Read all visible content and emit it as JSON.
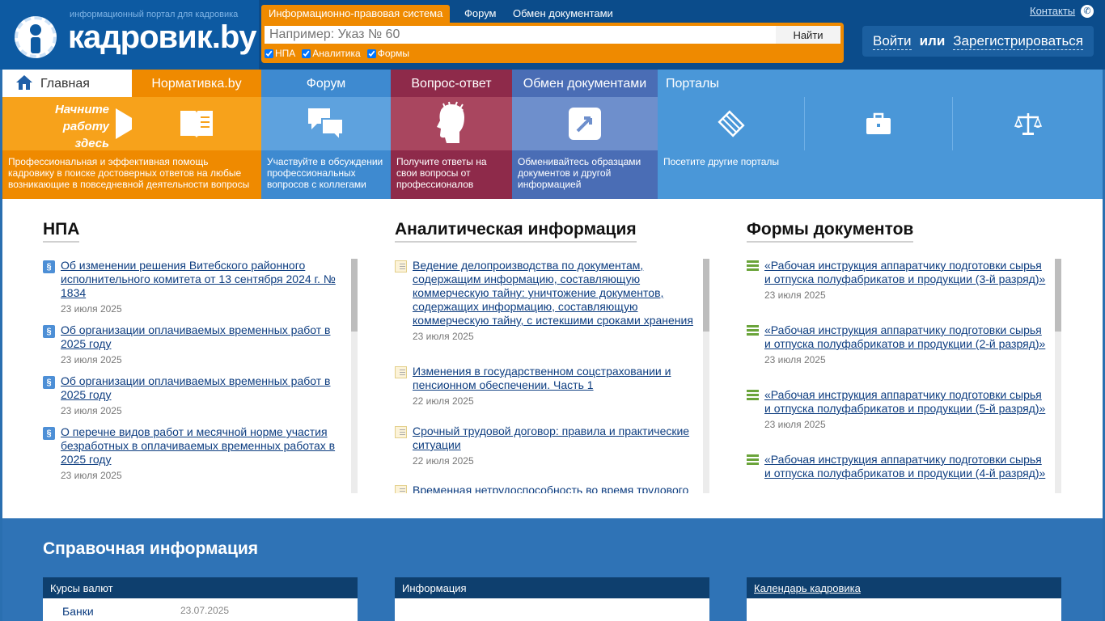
{
  "header": {
    "tagline": "информационный портал для кадровика",
    "brand": "кадровик.by",
    "search_tabs": [
      "Информационно-правовая система",
      "Форум",
      "Обмен документами"
    ],
    "search_placeholder": "Например: Указ № 60",
    "search_button": "Найти",
    "filters": [
      "НПА",
      "Аналитика",
      "Формы"
    ],
    "contacts": "Контакты",
    "login": "Войти",
    "or": "или",
    "register": "Зарегистрироваться"
  },
  "nav": {
    "home": "Главная",
    "start_here": "Начните работу здесь",
    "tabs": [
      "Нормативка.by",
      "Форум",
      "Вопрос-ответ",
      "Обмен документами",
      "Порталы"
    ],
    "descriptions": [
      "Профессиональная и эффективная помощь кадровику в поиске достоверных ответов на любые возникающие в повседневной деятельности вопросы",
      "Участвуйте в обсуждении профессиональных вопросов с коллегами",
      "Получите ответы на свои вопросы от профессионалов",
      "Обменивайтесь образцами документов и другой информацией",
      "Посетите другие порталы"
    ]
  },
  "columns": {
    "npa": {
      "title": "НПА",
      "items": [
        {
          "title": "Об изменении решения Витебского районного исполнительного комитета от 13 сентября 2024 г. № 1834",
          "date": "23 июля 2025"
        },
        {
          "title": "Об организации оплачиваемых временных работ в 2025 году",
          "date": "23 июля 2025"
        },
        {
          "title": "Об организации оплачиваемых временных работ в 2025 году",
          "date": "23 июля 2025"
        },
        {
          "title": "О перечне видов работ и месячной норме участия безработных в оплачиваемых временных работах в 2025 году",
          "date": "23 июля 2025"
        }
      ]
    },
    "analytics": {
      "title": "Аналитическая информация",
      "items": [
        {
          "title": "Ведение делопроизводства по документам, содержащим информацию, составляющую коммерческую тайну: уничтожение документов, содержащих информацию, составляющую коммерческую тайну, с истекшими сроками хранения",
          "date": "23 июля 2025"
        },
        {
          "title": "Изменения в государственном соцстраховании и пенсионном обеспечении. Часть 1",
          "date": "22 июля 2025"
        },
        {
          "title": "Срочный трудовой договор: правила и практические ситуации",
          "date": "22 июля 2025"
        },
        {
          "title": "Временная нетрудоспособность во время трудового",
          "date": ""
        }
      ]
    },
    "forms": {
      "title": "Формы документов",
      "items": [
        {
          "title": "«Рабочая инструкция аппаратчику подготовки сырья и отпуска полуфабрикатов и продукции (3-й разряд)»",
          "date": "23 июля 2025"
        },
        {
          "title": "«Рабочая инструкция аппаратчику подготовки сырья и отпуска полуфабрикатов и продукции (2-й разряд)»",
          "date": "23 июля 2025"
        },
        {
          "title": "«Рабочая инструкция аппаратчику подготовки сырья и отпуска полуфабрикатов и продукции (5-й разряд)»",
          "date": "23 июля 2025"
        },
        {
          "title": "«Рабочая инструкция аппаратчику подготовки сырья и отпуска полуфабрикатов и продукции (4-й разряд)»",
          "date": ""
        }
      ]
    }
  },
  "footer": {
    "title": "Справочная информация",
    "boxes": [
      "Курсы валют",
      "Информация",
      "Календарь кадровика"
    ],
    "banks_label": "Банки",
    "banks_date": "23.07.2025"
  },
  "colors": {
    "orange": "#ef8a00",
    "blue": "#4a97d8",
    "maroon": "#8e2a4a",
    "slate": "#4a6db5"
  }
}
